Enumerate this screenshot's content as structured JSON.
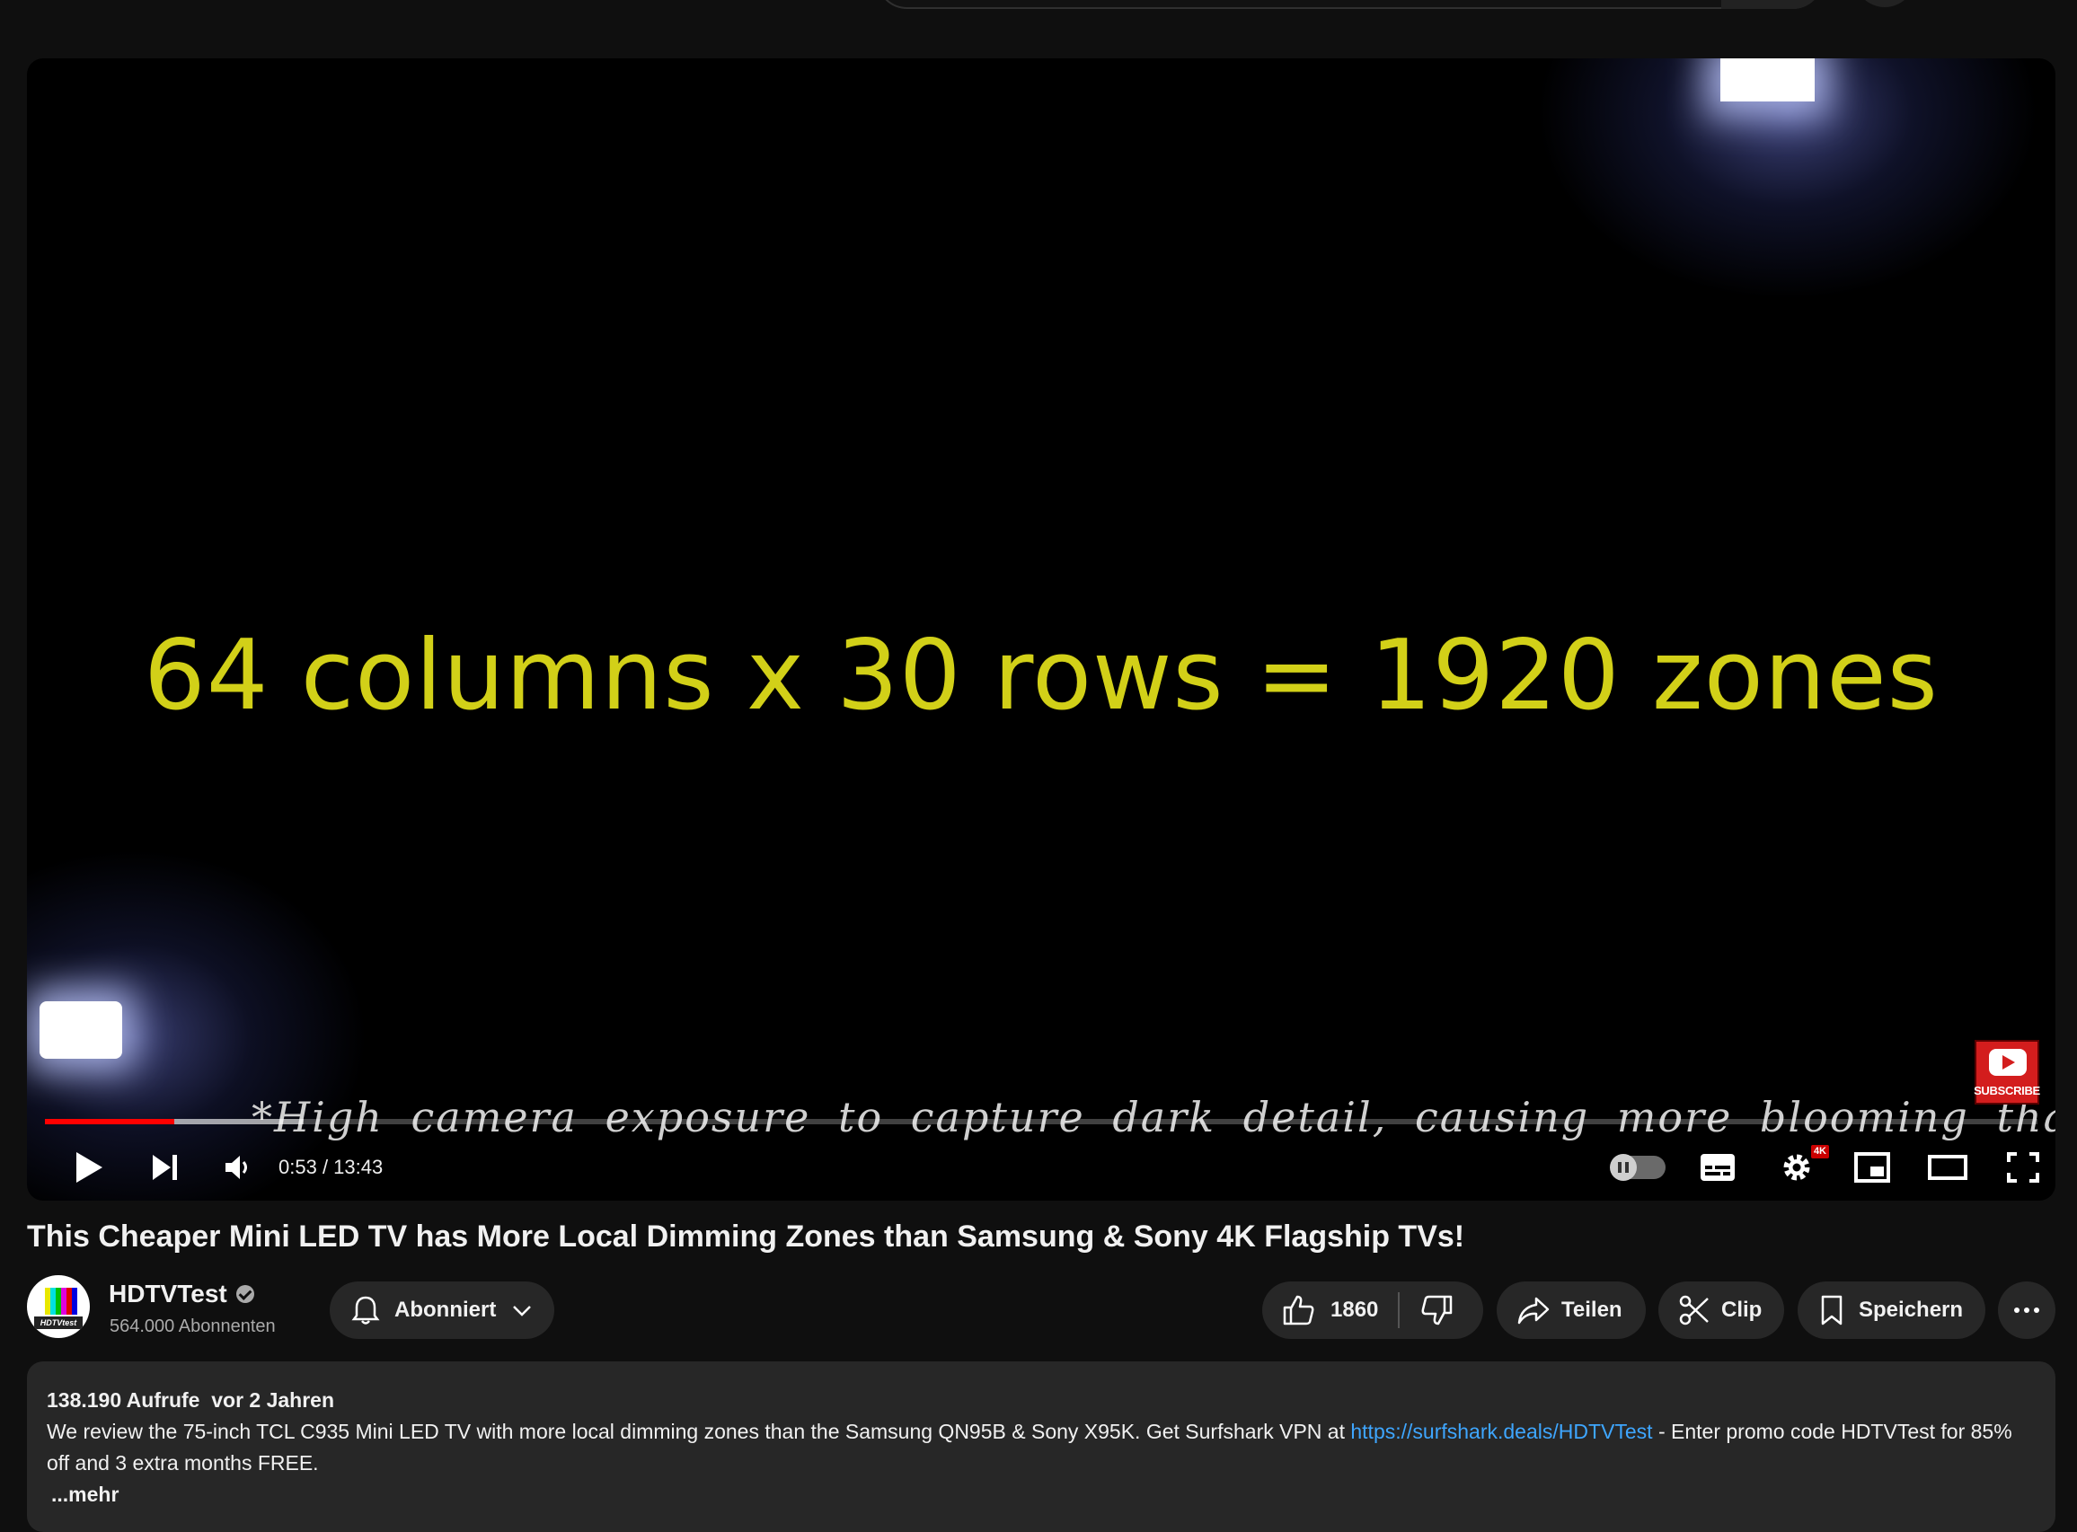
{
  "video": {
    "overlay_text": "64 columns x 30 rows = 1920 zones",
    "caption_text": "*High camera exposure to capture dark detail, causing more blooming than in real life.",
    "watermark_label": "SUBSCRIBE",
    "progress": {
      "played_fraction": 0.065,
      "buffered_fraction": 0.065
    }
  },
  "player": {
    "time_current": "0:53",
    "time_separator": " / ",
    "time_duration": "13:43",
    "quality_badge": "4K",
    "icons": [
      "play-icon",
      "next-icon",
      "volume-icon",
      "autoplay-toggle",
      "subtitles-icon",
      "settings-icon",
      "miniplayer-icon",
      "theater-mode-icon",
      "fullscreen-icon"
    ]
  },
  "title": "This Cheaper Mini LED TV has More Local Dimming Zones than Samsung & Sony 4K Flagship TVs!",
  "channel": {
    "name": "HDTVTest",
    "subscribers": "564.000 Abonnenten",
    "avatar_label": "HDTVtest",
    "avatar_colors": [
      "#ffffff",
      "#e8e800",
      "#00e0e0",
      "#00c000",
      "#e000e0",
      "#e00000",
      "#0000e0"
    ]
  },
  "actions": {
    "subscribe_label": "Abonniert",
    "like_count": "1860",
    "share_label": "Teilen",
    "clip_label": "Clip",
    "save_label": "Speichern"
  },
  "description": {
    "views": "138.190 Aufrufe",
    "date": "vor 2 Jahren",
    "text_before_link": "We review the 75-inch TCL C935 Mini LED TV with more local dimming zones than the Samsung QN95B & Sony X95K. Get Surfshark VPN at ",
    "link": "https://surfshark.deals/HDTVTest",
    "text_after_link": " - Enter promo code HDTVTest for 85% off and 3 extra months FREE.",
    "more_label": "...mehr"
  },
  "colors": {
    "background": "#0f0f0f",
    "accent_red": "#ff0000",
    "link": "#3ea6ff",
    "overlay_yellow": "#d2d018"
  }
}
